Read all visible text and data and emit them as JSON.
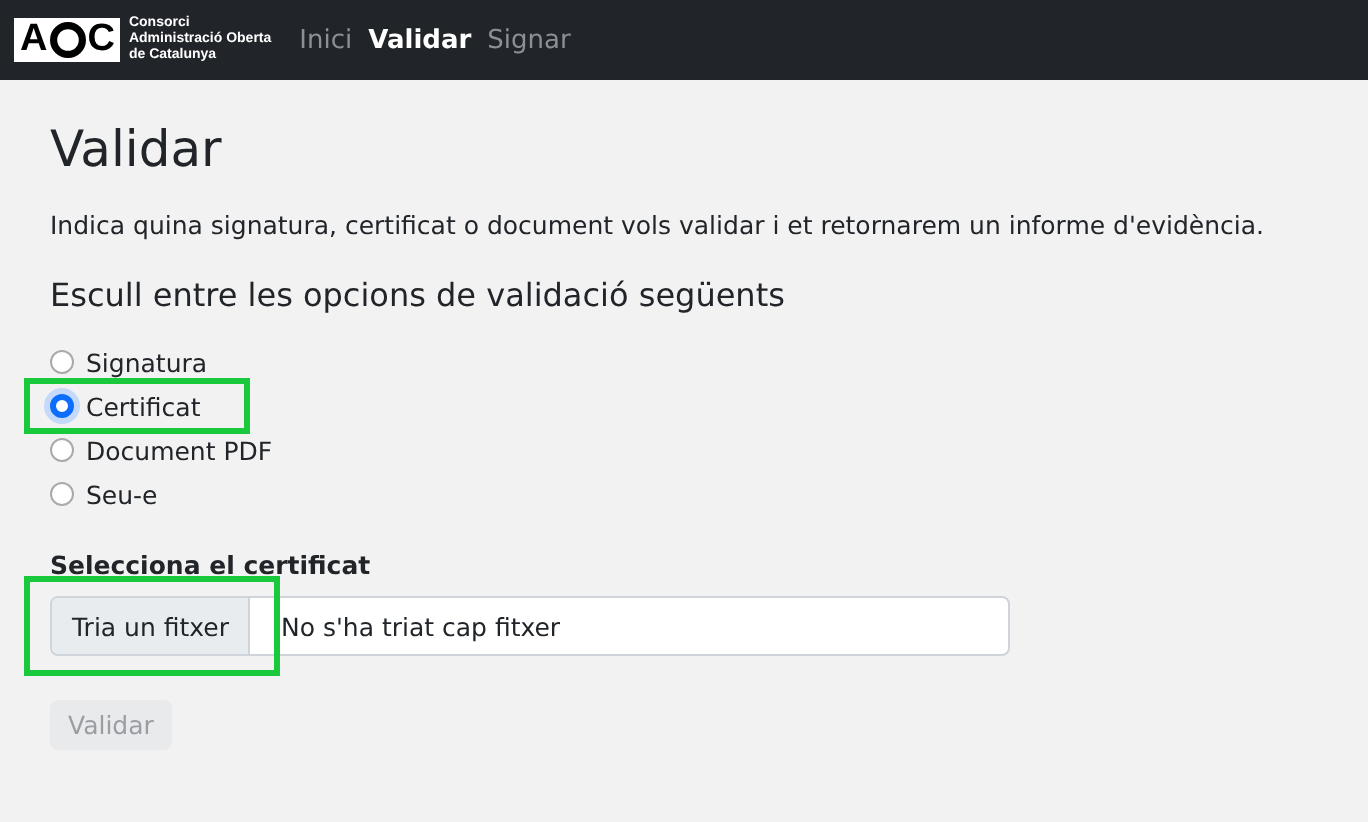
{
  "logo": {
    "left_letter": "A",
    "right_letter": "C",
    "org_lines": [
      "Consorci",
      "Administració Oberta",
      "de Catalunya"
    ]
  },
  "nav": [
    {
      "label": "Inici",
      "selected": false
    },
    {
      "label": "Validar",
      "selected": true
    },
    {
      "label": "Signar",
      "selected": false
    }
  ],
  "title": "Validar",
  "intro": "Indica quina signatura, certificat o document vols validar i et retornarem un informe d'evidència.",
  "options_heading": "Escull entre les opcions de validació següents",
  "options": [
    {
      "label": "Signatura",
      "selected": false,
      "highlighted": false
    },
    {
      "label": "Certificat",
      "selected": true,
      "highlighted": true
    },
    {
      "label": "Document PDF",
      "selected": false,
      "highlighted": false
    },
    {
      "label": "Seu-e",
      "selected": false,
      "highlighted": false
    }
  ],
  "file_input": {
    "label": "Selecciona el certificat",
    "button": "Tria un fitxer",
    "value": "No s'ha triat cap fitxer",
    "highlighted": true
  },
  "submit": {
    "label": "Validar",
    "disabled": true
  }
}
